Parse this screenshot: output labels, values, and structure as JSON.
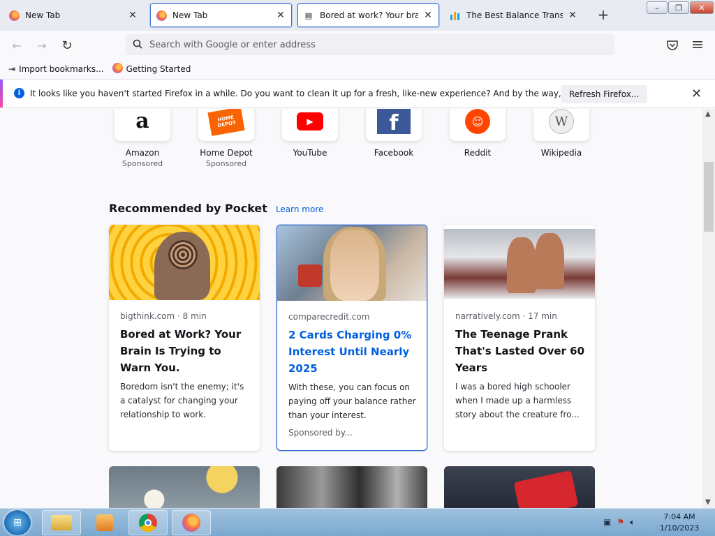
{
  "tabs": [
    {
      "title": "New Tab",
      "icon": "firefox-icon",
      "active": false
    },
    {
      "title": "New Tab",
      "icon": "firefox-icon",
      "active": true
    },
    {
      "title": "Bored at work? Your brain is t",
      "icon": "reader-icon",
      "active": false
    },
    {
      "title": "The Best Balance Transfer Ca",
      "icon": "bar-chart-icon",
      "active": false
    }
  ],
  "new_tab_symbol": "+",
  "window_controls": {
    "minimize": "–",
    "maximize": "❐",
    "close": "✕"
  },
  "nav": {
    "back": "←",
    "forward": "→",
    "reload": "↻"
  },
  "urlbar": {
    "placeholder": "Search with Google or enter address"
  },
  "toolbar_icons": [
    "pocket-icon",
    "menu-icon"
  ],
  "bookmarks": [
    {
      "label": "Import bookmarks...",
      "icon": "import-icon"
    },
    {
      "label": "Getting Started",
      "icon": "firefox-icon"
    }
  ],
  "notification": {
    "message": "It looks like you haven't started Firefox in a while. Do you want to clean it up for a fresh, like-new experience? And by the way, welcome back!",
    "button": "Refresh Firefox...",
    "close": "✕"
  },
  "top_sites": [
    {
      "name": "Amazon",
      "sub": "Sponsored",
      "logo": "a"
    },
    {
      "name": "Home Depot",
      "sub": "Sponsored",
      "logo": "HOME DEPOT"
    },
    {
      "name": "YouTube",
      "sub": "",
      "logo": "▶"
    },
    {
      "name": "Facebook",
      "sub": "",
      "logo": "f"
    },
    {
      "name": "Reddit",
      "sub": "",
      "logo": "☺"
    },
    {
      "name": "Wikipedia",
      "sub": "",
      "logo": "W"
    }
  ],
  "pocket": {
    "heading": "Recommended by Pocket",
    "learn_more": "Learn more",
    "cards": [
      {
        "source": "bigthink.com · 8 min",
        "title": "Bored at Work? Your Brain Is Trying to Warn You.",
        "excerpt": "Boredom isn't the enemy; it's a catalyst for changing your relationship to work.",
        "sponsored": ""
      },
      {
        "source": "comparecredit.com",
        "title": "2 Cards Charging 0% Interest Until Nearly 2025",
        "excerpt": "With these, you can focus on paying off your balance rather than your interest.",
        "sponsored": "Sponsored by..."
      },
      {
        "source": "narratively.com · 17 min",
        "title": "The Teenage Prank That's Lasted Over 60 Years",
        "excerpt": "I was a bored high schooler when I made up a harmless story about the creature fro...",
        "sponsored": ""
      }
    ]
  },
  "taskbar": {
    "apps": [
      "windows-explorer-icon",
      "media-player-icon",
      "chrome-icon",
      "firefox-icon"
    ],
    "time": "7:04 AM",
    "date": "1/10/2023"
  },
  "colors": {
    "accent": "#0060df",
    "tab_border": "#3b6fd4",
    "taskbar": "#7aa8cf"
  }
}
